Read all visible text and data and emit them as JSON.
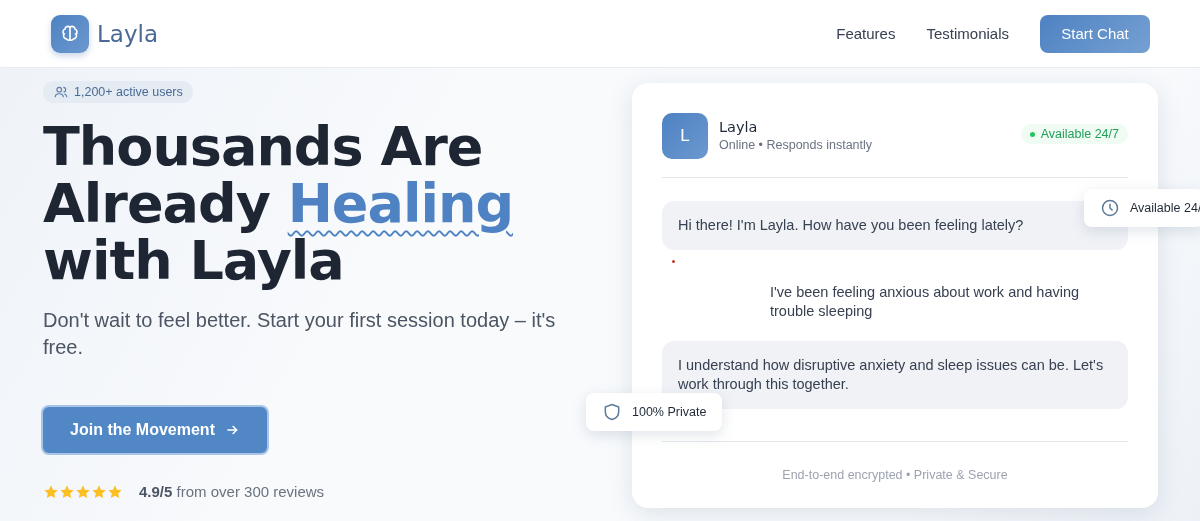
{
  "header": {
    "brand": "Layla",
    "nav": [
      {
        "label": "Features"
      },
      {
        "label": "Testimonials"
      }
    ],
    "cta": "Start Chat"
  },
  "hero": {
    "badge": "1,200+ active users",
    "headline": [
      [
        {
          "text": "Thousands Are",
          "highlight": false
        }
      ],
      [
        {
          "text": "Already ",
          "highlight": false
        },
        {
          "text": "Healing",
          "highlight": true
        }
      ],
      [
        {
          "text": "with Layla",
          "highlight": false
        }
      ]
    ],
    "subtitle": "Don't wait to feel better. Start your first session today – it's free.",
    "button": "Join the Movement",
    "rating": {
      "stars": 5,
      "text": "**4.9/5** from over 300 reviews"
    }
  },
  "chat": {
    "avatar": "L",
    "name": "Layla",
    "status": "Online • Responds instantly",
    "availability": "Available 24/7",
    "messages": [
      {
        "kind": "bot",
        "text": "Hi there! I'm Layla. How have you been feeling lately?"
      },
      {
        "kind": "user",
        "text": "I've been feeling anxious about work and having trouble sleeping"
      },
      {
        "kind": "bot",
        "text": "I understand how disruptive anxiety and sleep issues can be. Let's work through this together."
      }
    ],
    "footer": "End-to-end encrypted • Private & Secure"
  },
  "floating": [
    {
      "kind": "clock",
      "label": "Available 24/"
    },
    {
      "kind": "shield",
      "label": "100% Private"
    }
  ]
}
